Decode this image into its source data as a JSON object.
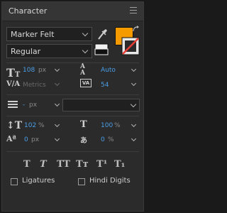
{
  "panel": {
    "title": "Character"
  },
  "font": {
    "family": "Marker Felt",
    "style": "Regular"
  },
  "colors": {
    "fill": "#f59b00",
    "stroke": "#e83c33"
  },
  "size": {
    "value": "108",
    "unit": "px"
  },
  "leading": {
    "value": "Auto"
  },
  "kerning": {
    "value": "Metrics"
  },
  "tracking": {
    "value": "54"
  },
  "indent": {
    "value": "-",
    "unit": "px"
  },
  "vertical_scale": {
    "value": "102",
    "unit": "%"
  },
  "horizontal_scale": {
    "value": "100",
    "unit": "%"
  },
  "baseline_shift": {
    "value": "0",
    "unit": "px"
  },
  "tsume": {
    "value": "0",
    "unit": "%"
  },
  "style_buttons": [
    "T",
    "T",
    "TT",
    "Tт",
    "T¹",
    "T₁"
  ],
  "options": {
    "ligatures": "Ligatures",
    "hindi_digits": "Hindi Digits"
  }
}
